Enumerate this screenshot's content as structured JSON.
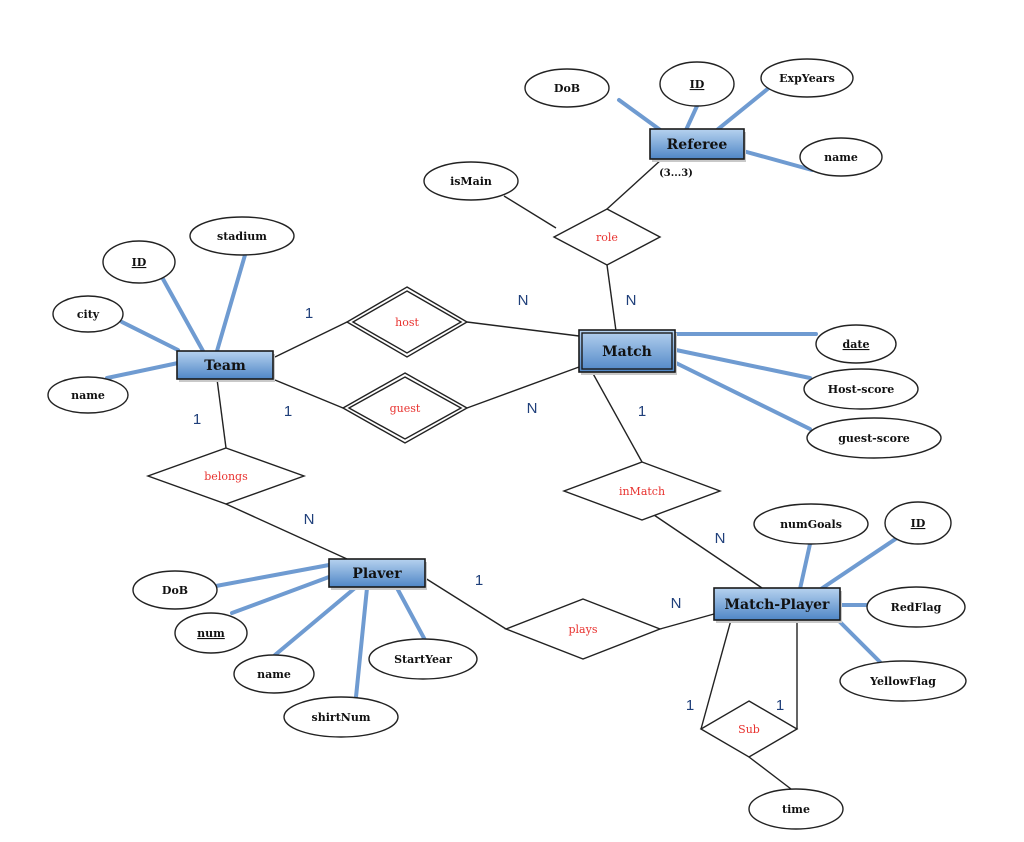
{
  "diagram": {
    "type": "entity-relationship",
    "colors": {
      "entity_fill_top": "#a9c8ea",
      "entity_fill_bottom": "#4f86c6",
      "entity_border": "#1a1a1a",
      "attribute_link": "#6f9bd1",
      "relationship_text": "#e8322f",
      "cardinality_text": "#1f3f7a",
      "line": "#222222"
    },
    "entities": [
      {
        "id": "referee",
        "label": "Referee",
        "weak": false
      },
      {
        "id": "team",
        "label": "Team",
        "weak": false
      },
      {
        "id": "match",
        "label": "Match",
        "weak": true
      },
      {
        "id": "player",
        "label": "Plaver",
        "weak": false
      },
      {
        "id": "match_player",
        "label": "Match-Player",
        "weak": false
      }
    ],
    "attributes": [
      {
        "id": "ref_dob",
        "label": "DoB",
        "key": false,
        "entity": "referee"
      },
      {
        "id": "ref_id",
        "label": "ID",
        "key": true,
        "entity": "referee"
      },
      {
        "id": "ref_exp",
        "label": "ExpYears",
        "key": false,
        "entity": "referee"
      },
      {
        "id": "ref_name",
        "label": "name",
        "key": false,
        "entity": "referee"
      },
      {
        "id": "role_ismain",
        "label": "isMain",
        "key": false,
        "entity": "role"
      },
      {
        "id": "team_stadium",
        "label": "stadium",
        "key": false,
        "entity": "team"
      },
      {
        "id": "team_id",
        "label": "ID",
        "key": true,
        "entity": "team"
      },
      {
        "id": "team_city",
        "label": "city",
        "key": false,
        "entity": "team"
      },
      {
        "id": "team_name",
        "label": "name",
        "key": false,
        "entity": "team"
      },
      {
        "id": "match_date",
        "label": "date",
        "key": true,
        "entity": "match"
      },
      {
        "id": "match_hscore",
        "label": "Host-score",
        "key": false,
        "entity": "match"
      },
      {
        "id": "match_gscore",
        "label": "guest-score",
        "key": false,
        "entity": "match"
      },
      {
        "id": "mp_goals",
        "label": "numGoals",
        "key": false,
        "entity": "match_player"
      },
      {
        "id": "mp_id",
        "label": "ID",
        "key": true,
        "entity": "match_player"
      },
      {
        "id": "mp_red",
        "label": "RedFlag",
        "key": false,
        "entity": "match_player"
      },
      {
        "id": "mp_yellow",
        "label": "YellowFlag",
        "key": false,
        "entity": "match_player"
      },
      {
        "id": "sub_time",
        "label": "time",
        "key": false,
        "entity": "sub"
      },
      {
        "id": "pl_dob",
        "label": "DoB",
        "key": false,
        "entity": "player"
      },
      {
        "id": "pl_num",
        "label": "num",
        "key": true,
        "entity": "player"
      },
      {
        "id": "pl_name",
        "label": "name",
        "key": false,
        "entity": "player"
      },
      {
        "id": "pl_shirt",
        "label": "shirtNum",
        "key": false,
        "entity": "player"
      },
      {
        "id": "pl_start",
        "label": "StartYear",
        "key": false,
        "entity": "player"
      }
    ],
    "relationships": [
      {
        "id": "role",
        "label": "role",
        "identifying": false
      },
      {
        "id": "host",
        "label": "host",
        "identifying": true
      },
      {
        "id": "guest",
        "label": "guest",
        "identifying": true
      },
      {
        "id": "belongs",
        "label": "belongs",
        "identifying": false
      },
      {
        "id": "inmatch",
        "label": "inMatch",
        "identifying": false
      },
      {
        "id": "plays",
        "label": "plays",
        "identifying": false
      },
      {
        "id": "sub",
        "label": "Sub",
        "identifying": false
      }
    ],
    "cardinalities": [
      {
        "id": "c_host_team",
        "label": "1"
      },
      {
        "id": "c_host_match",
        "label": "N"
      },
      {
        "id": "c_role_match",
        "label": "N"
      },
      {
        "id": "c_guest_team",
        "label": "1"
      },
      {
        "id": "c_guest_match",
        "label": "N"
      },
      {
        "id": "c_belongs_team",
        "label": "1"
      },
      {
        "id": "c_belongs_player",
        "label": "N"
      },
      {
        "id": "c_inmatch_match",
        "label": "1"
      },
      {
        "id": "c_inmatch_mp",
        "label": "N"
      },
      {
        "id": "c_plays_player",
        "label": "1"
      },
      {
        "id": "c_plays_mp",
        "label": "N"
      },
      {
        "id": "c_sub_left",
        "label": "1"
      },
      {
        "id": "c_sub_right",
        "label": "1"
      }
    ],
    "notes": [
      {
        "id": "referee_participation",
        "label": "(3...3)"
      }
    ]
  }
}
